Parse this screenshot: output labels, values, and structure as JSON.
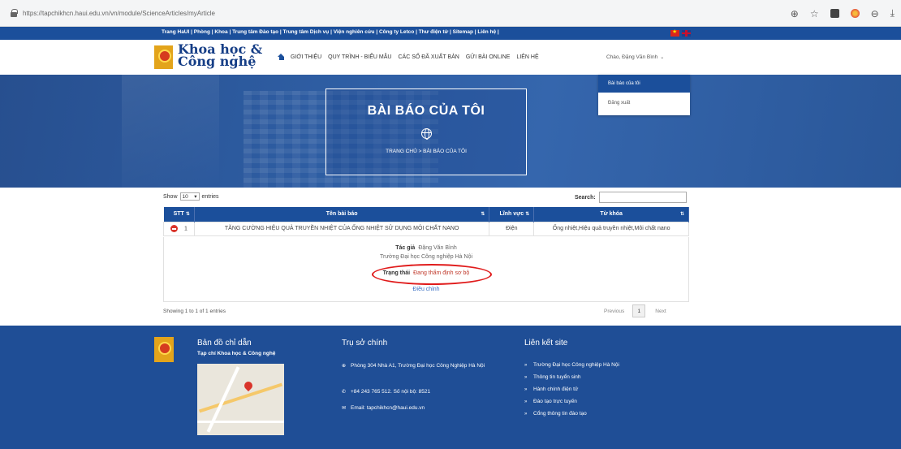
{
  "browser": {
    "url": "https://tapchikhcn.haui.edu.vn/vn/module/ScienceArticles/myArticle"
  },
  "top_links": "Trang HaUI | Phòng | Khoa | Trung tâm Đào tạo | Trung tâm Dịch vụ | Viện nghiên cứu | Công ty Letco | Thư điện tử | Sitemap | Liên hệ |",
  "logo": {
    "line1": "Khoa học &",
    "line2": "Công nghệ"
  },
  "nav": {
    "items": [
      "GIỚI THIỆU",
      "QUY TRÌNH - BIỂU MẪU",
      "CÁC SỐ ĐÃ XUẤT BẢN",
      "GỬI BÀI ONLINE",
      "LIÊN HỆ"
    ],
    "user": "Chào, Đặng Văn Bình"
  },
  "dropdown": {
    "active": "Bài báo của tôi",
    "item": "Đăng xuất"
  },
  "hero": {
    "title": "BÀI BÁO CỦA TÔI",
    "breadcrumb": "TRANG CHỦ > BÀI BÁO CỦA TÔI"
  },
  "table_controls": {
    "show_label": "Show",
    "show_value": "10",
    "entries_label": "entries",
    "search_label": "Search:"
  },
  "table": {
    "headers": [
      "STT",
      "Tên bài báo",
      "Lĩnh vực",
      "Từ khóa"
    ],
    "rows": [
      {
        "stt": "1",
        "title": "TĂNG CƯỜNG HIỆU QUẢ TRUYỀN NHIỆT CỦA ỐNG NHIỆT SỬ DỤNG MÔI CHẤT NANO",
        "field": "Điện",
        "keywords": "Ống nhiệt,Hiệu quả truyền nhiệt,Môi chất nano"
      }
    ],
    "detail": {
      "author_label": "Tác giả",
      "author": "Đặng Văn Bình",
      "org": "Trường Đại học Công nghiệp Hà Nội",
      "status_label": "Trạng thái",
      "status": "Đang thẩm định sơ bộ",
      "edit": "Điều chỉnh"
    }
  },
  "showing": "Showing 1 to 1 of 1 entries",
  "pager": {
    "prev": "Previous",
    "page": "1",
    "next": "Next"
  },
  "footer": {
    "map_title": "Bản đồ chỉ dẫn",
    "map_sub": "Tạp chí Khoa học & Công nghệ",
    "office_title": "Trụ sở chính",
    "address": "Phòng 304 Nhà A1, Trường Đại học Công Nghiệp Hà Nội",
    "phone": "+84 243 765 512. Số nội bộ: 8521",
    "email": "Email: tapchikhcn@haui.edu.vn",
    "links_title": "Liên kết site",
    "links": [
      "Trường Đại học Công nghiệp Hà Nội",
      "Thông tin tuyển sinh",
      "Hành chính điện tử",
      "Đào tạo trực tuyến",
      "Cổng thông tin đào tạo"
    ]
  }
}
